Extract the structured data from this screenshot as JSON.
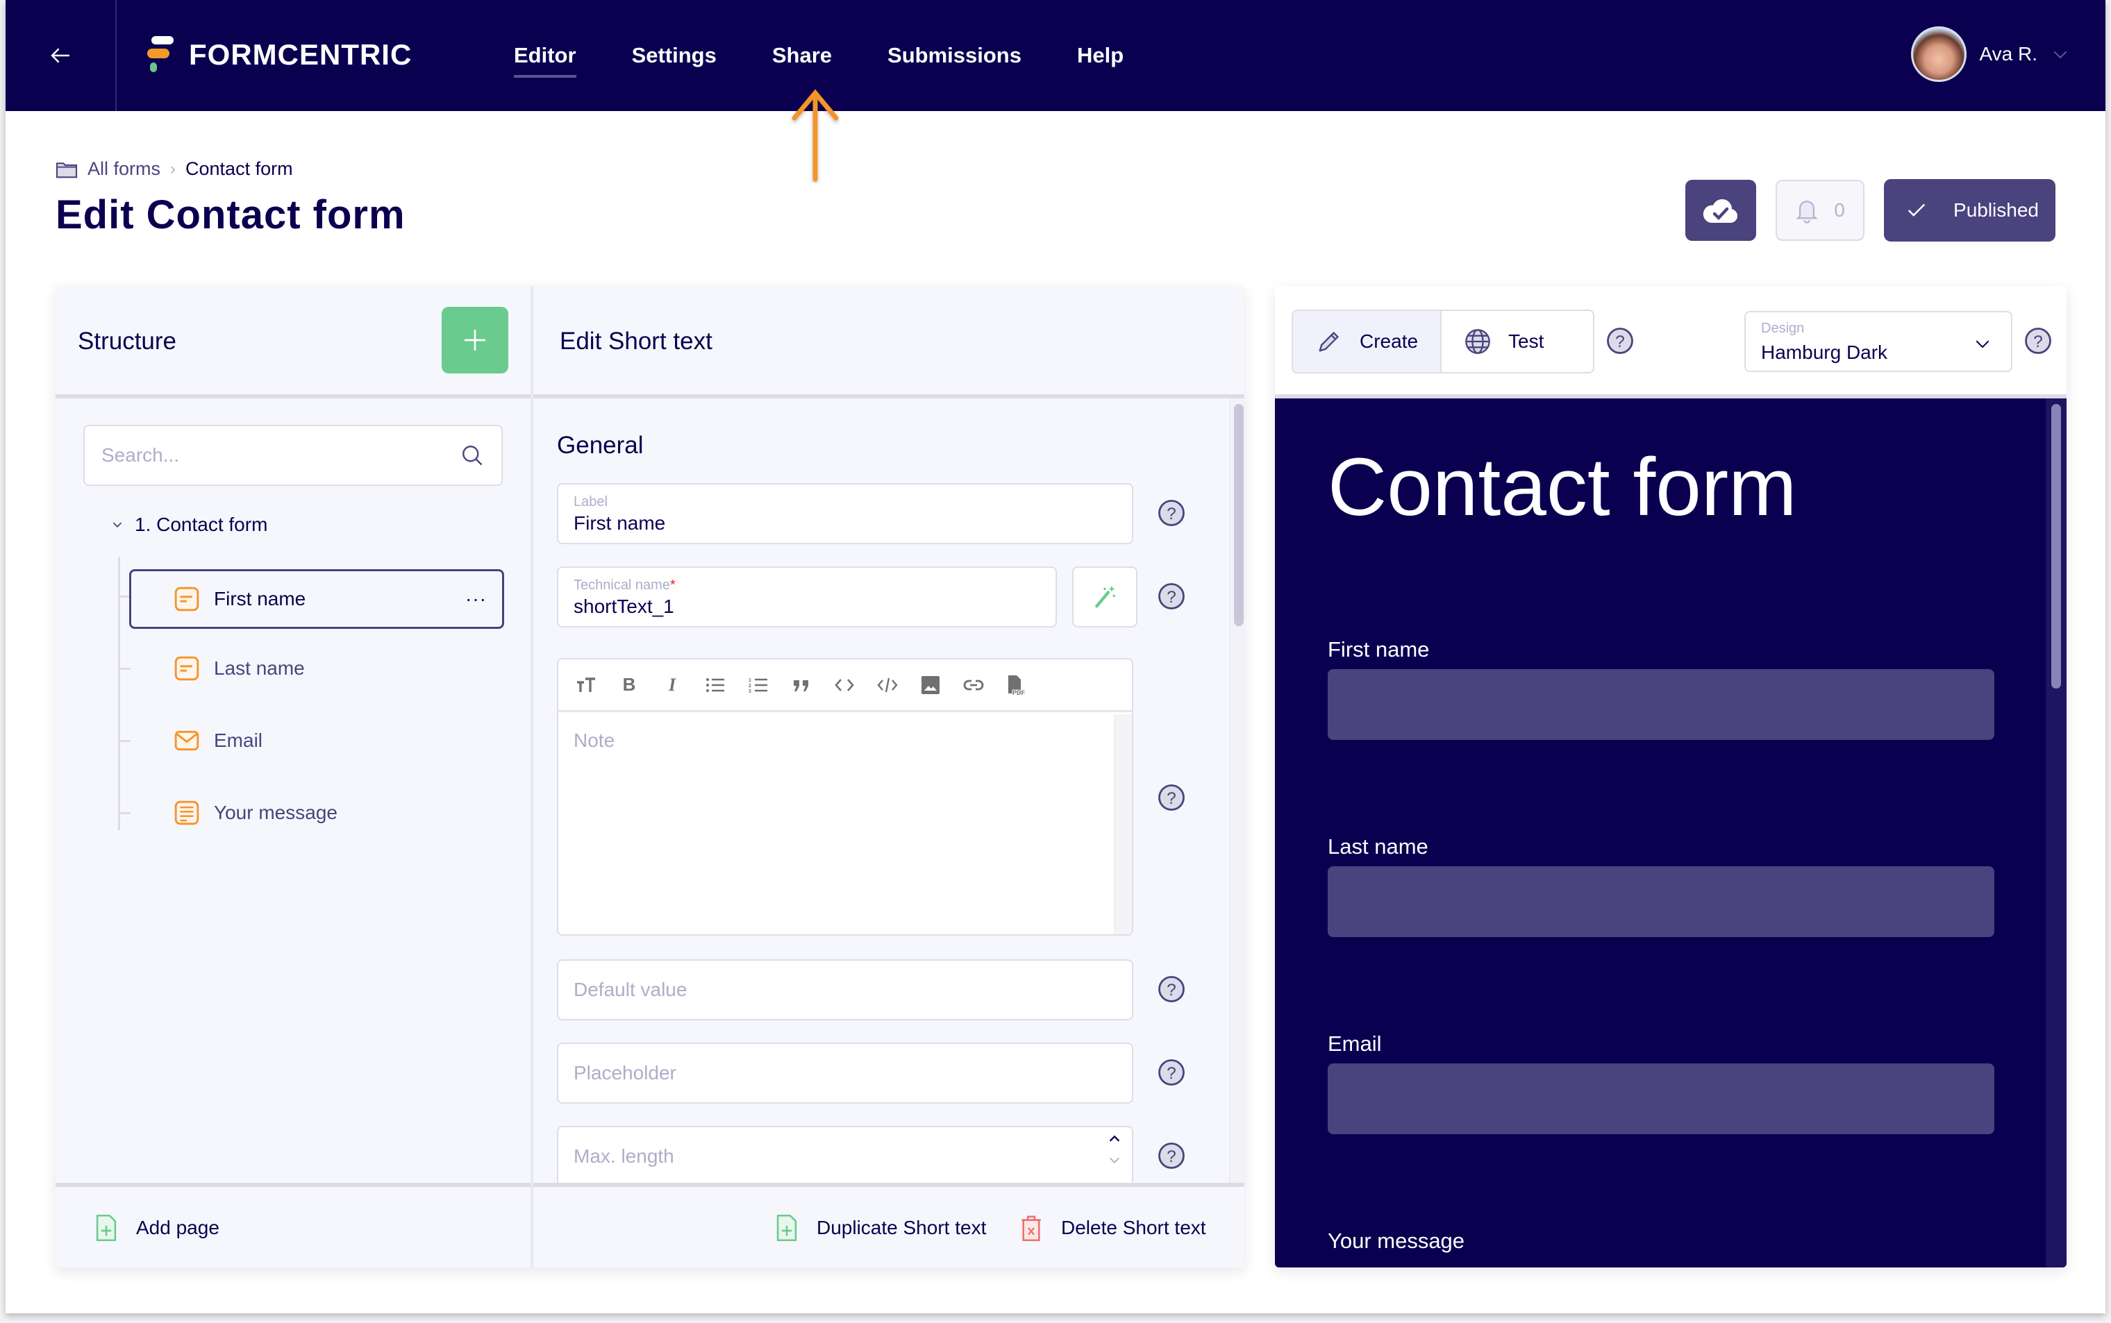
{
  "header": {
    "back_icon": "arrow-left-icon",
    "brand": "FORMCENTRIC",
    "nav": [
      {
        "label": "Editor",
        "active": true
      },
      {
        "label": "Settings",
        "active": false
      },
      {
        "label": "Share",
        "active": false
      },
      {
        "label": "Submissions",
        "active": false
      },
      {
        "label": "Help",
        "active": false
      }
    ],
    "user": {
      "name": "Ava R.",
      "menu_icon": "chevron-down-icon"
    },
    "annotation_arrow_color": "#f4942a"
  },
  "breadcrumb": {
    "icon": "folder-icon",
    "items": [
      "All forms",
      "Contact form"
    ]
  },
  "page_title": "Edit Contact form",
  "actions": {
    "save_icon": "cloud-check-icon",
    "notifications_count": "0",
    "published_label": "Published"
  },
  "structure": {
    "title": "Structure",
    "add_icon": "plus-icon",
    "search_placeholder": "Search...",
    "page": "1. Contact form",
    "items": [
      {
        "label": "First name",
        "icon": "short-text-icon",
        "selected": true
      },
      {
        "label": "Last name",
        "icon": "short-text-icon",
        "selected": false
      },
      {
        "label": "Email",
        "icon": "email-icon",
        "selected": false
      },
      {
        "label": "Your message",
        "icon": "long-text-icon",
        "selected": false
      }
    ],
    "more_label": "···",
    "add_page_label": "Add page"
  },
  "edit": {
    "title": "Edit Short text",
    "section": "General",
    "label_field": {
      "label": "Label",
      "value": "First name"
    },
    "technical_field": {
      "label": "Technical name",
      "required_mark": "*",
      "value": "shortText_1"
    },
    "note_placeholder": "Note",
    "default_value_placeholder": "Default value",
    "placeholder_placeholder": "Placeholder",
    "max_length_placeholder": "Max. length",
    "toolbar": [
      "font-size",
      "bold",
      "italic",
      "bullet-list",
      "numbered-list",
      "quote",
      "code",
      "code-block",
      "image",
      "link",
      "pdf"
    ],
    "duplicate_label": "Duplicate Short text",
    "delete_label": "Delete Short text"
  },
  "preview": {
    "modes": [
      {
        "label": "Create",
        "icon": "pencil-icon",
        "active": true
      },
      {
        "label": "Test",
        "icon": "globe-icon",
        "active": false
      }
    ],
    "design_label": "Design",
    "design_value": "Hamburg Dark",
    "form_title": "Contact form",
    "fields": [
      "First name",
      "Last name",
      "Email",
      "Your message"
    ]
  },
  "colors": {
    "navy": "#0b0050",
    "accent_purple": "#4a437e",
    "green": "#6acb8e",
    "orange": "#f4942a",
    "red": "#f07070"
  }
}
